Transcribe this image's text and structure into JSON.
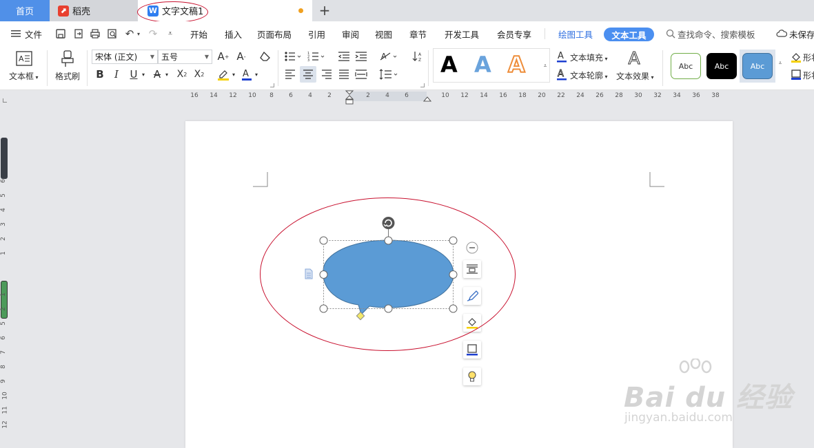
{
  "tabs": {
    "home": "首页",
    "daoke": "稻壳",
    "document": "文字文稿1",
    "add": "+"
  },
  "menu": {
    "file": "文件",
    "items": [
      "开始",
      "插入",
      "页面布局",
      "引用",
      "审阅",
      "视图",
      "章节",
      "开发工具",
      "会员专享"
    ],
    "drawing_tools": "绘图工具",
    "text_tools": "文本工具",
    "search": "查找命令、搜索模板",
    "unsaved": "未保存"
  },
  "ribbon": {
    "textbox": "文本框",
    "format_painter": "格式刷",
    "font_name": "宋体 (正文)",
    "font_size": "五号",
    "text_fill": "文本填充",
    "text_outline": "文本轮廓",
    "text_effect": "文本效果",
    "shape_styles": [
      "Abc",
      "Abc",
      "Abc"
    ],
    "shape_fill": "形状",
    "shape_outline": "形状"
  },
  "ruler": {
    "h_ticks": [
      "16",
      "14",
      "12",
      "10",
      "8",
      "6",
      "4",
      "2",
      "2",
      "4",
      "6",
      "10",
      "12",
      "14",
      "16",
      "18",
      "20",
      "22",
      "24",
      "26",
      "28",
      "30",
      "32",
      "34",
      "36",
      "38"
    ],
    "v_ticks": [
      "6",
      "5",
      "4",
      "3",
      "2",
      "1",
      "1",
      "2",
      "3",
      "4",
      "5",
      "6",
      "7",
      "8",
      "9",
      "10",
      "11",
      "12"
    ]
  },
  "watermark": {
    "logo": "Bai du 经验",
    "url": "jingyan.baidu.com"
  },
  "colors": {
    "accent": "#4b8ff0",
    "shape_fill": "#5b9bd5",
    "annotation": "#c8102e",
    "home_tab": "#5090e8"
  }
}
